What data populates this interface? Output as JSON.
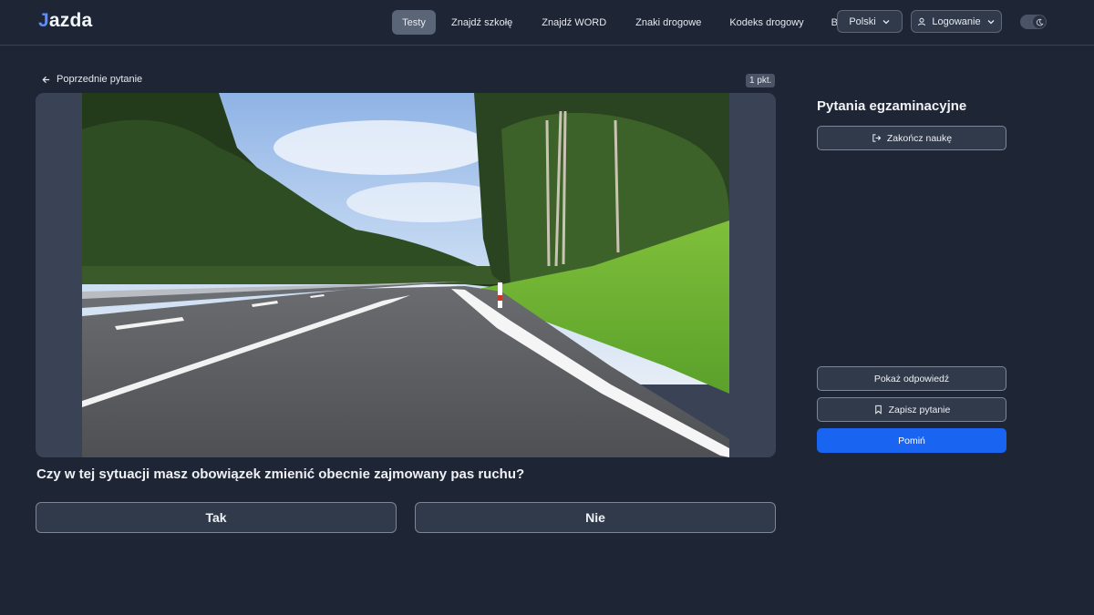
{
  "header": {
    "logo_mark": "J",
    "logo_text": "azda",
    "nav": [
      {
        "label": "Testy",
        "active": true
      },
      {
        "label": "Znajdź szkołę"
      },
      {
        "label": "Znajdź WORD"
      },
      {
        "label": "Znaki drogowe"
      },
      {
        "label": "Kodeks drogowy"
      },
      {
        "label": "Blog"
      }
    ],
    "language": "Polski",
    "login": "Logowanie",
    "theme_icon": "moon-icon"
  },
  "question": {
    "back_label": "Poprzednie pytanie",
    "points": "1 pkt.",
    "text": "Czy w tej sytuacji masz obowiązek zmienić obecnie zajmowany pas ruchu?",
    "answers": {
      "yes": "Tak",
      "no": "Nie"
    }
  },
  "sidebar": {
    "title": "Pytania egzaminacyjne",
    "finish_label": "Zakończ naukę",
    "show_answer_label": "Pokaż odpowiedź",
    "save_label": "Zapisz pytanie",
    "skip_label": "Pomiń"
  },
  "colors": {
    "background": "#1e2534",
    "accent": "#1a64f2",
    "active_nav": "#5a6577"
  }
}
